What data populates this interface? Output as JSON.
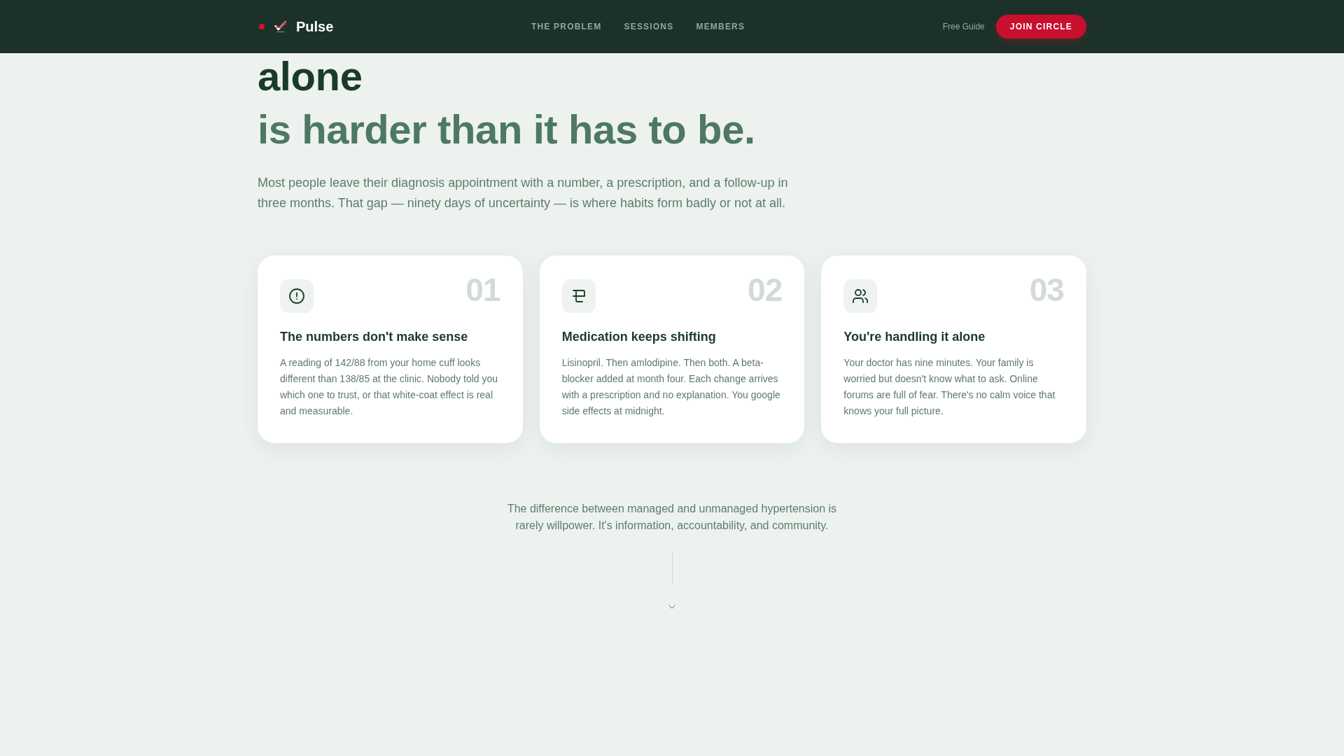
{
  "nav": {
    "brand": "Pulse",
    "links": [
      {
        "label": "THE PROBLEM"
      },
      {
        "label": "SESSIONS"
      },
      {
        "label": "MEMBERS"
      }
    ],
    "guide_link": "Free Guide",
    "cta": "JOIN CIRCLE"
  },
  "hero": {
    "heading_line_1": "alone",
    "heading_line_2": "is harder than it has to be.",
    "intro": "Most people leave their diagnosis appointment with a number, a prescription, and a follow-up in three months. That gap — ninety days of uncertainty — is where habits form badly or not at all."
  },
  "cards": [
    {
      "number": "01",
      "title": "The numbers don't make sense",
      "body": "A reading of 142/88 from your home cuff looks different than 138/85 at the clinic. Nobody told you which one to trust, or that white-coat effect is real and measurable."
    },
    {
      "number": "02",
      "title": "Medication keeps shifting",
      "body": "Lisinopril. Then amlodipine. Then both. A beta-blocker added at month four. Each change arrives with a prescription and no explanation. You google side effects at midnight."
    },
    {
      "number": "03",
      "title": "You're handling it alone",
      "body": "Your doctor has nine minutes. Your family is worried but doesn't know what to ask. Online forums are full of fear. There's no calm voice that knows your full picture."
    }
  ],
  "closing": {
    "text": "The difference between managed and unmanaged hypertension is rarely willpower. It's information, accountability, and community."
  }
}
